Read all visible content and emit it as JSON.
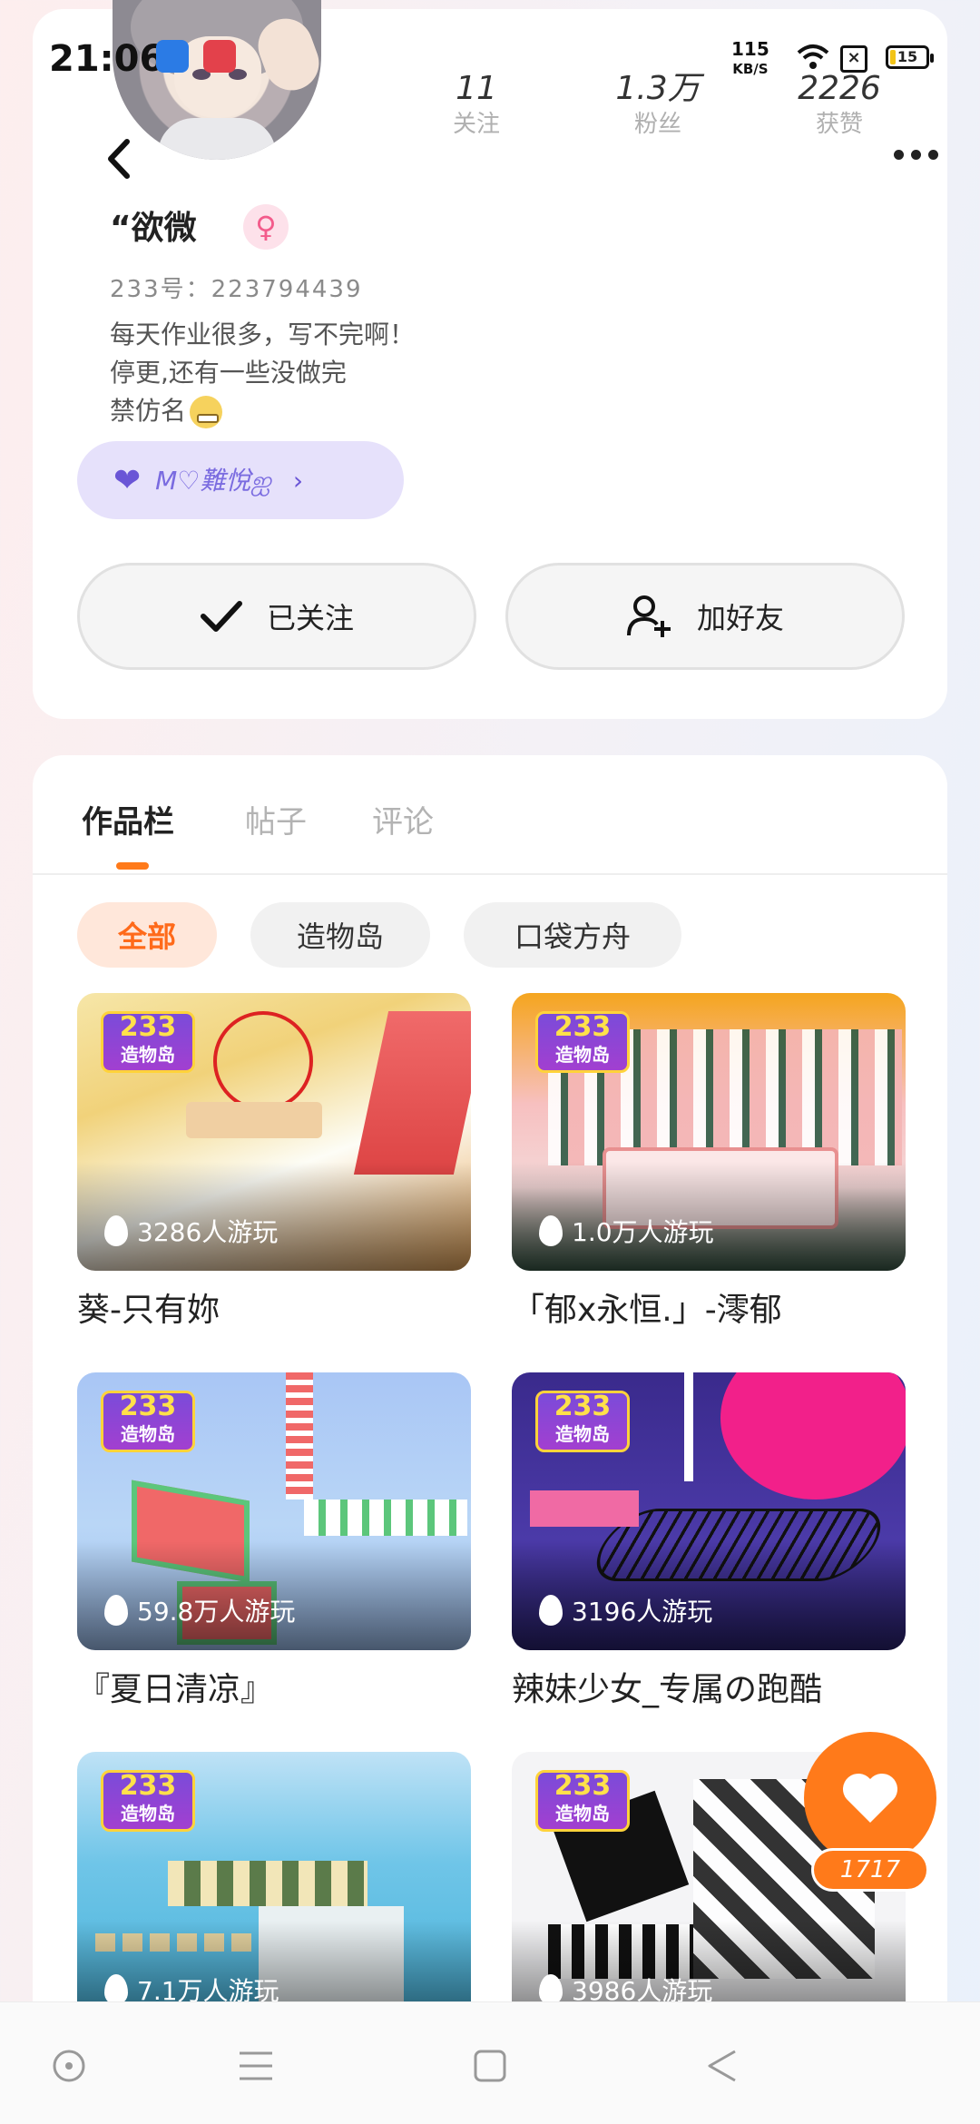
{
  "status_bar": {
    "time": "21:06",
    "net_speed_value": "115",
    "net_speed_unit": "KB/S",
    "battery": "15"
  },
  "profile": {
    "stats": [
      {
        "value": "11",
        "label": "关注"
      },
      {
        "value": "1.3万",
        "label": "粉丝"
      },
      {
        "value": "2226",
        "label": "获赞"
      }
    ],
    "nickname": "“欲微",
    "gender_symbol": "♀",
    "user_id": "233号：223794439",
    "bio_lines": [
      "每天作业很多，写不完啊！",
      "停更,还有一些没做完",
      "禁仿名"
    ],
    "badge_text": "M♡難悅ஐ",
    "follow_button": "已关注",
    "add_friend_button": "加好友"
  },
  "tabs": [
    "作品栏",
    "帖子",
    "评论"
  ],
  "filters": [
    "全部",
    "造物岛",
    "口袋方舟"
  ],
  "games": [
    {
      "title": "葵-只有妳",
      "plays": "3286人游玩",
      "logo_top": "233",
      "logo_bottom": "造物岛"
    },
    {
      "title": "「郁x永恒.」-澪郁",
      "plays": "1.0万人游玩",
      "logo_top": "233",
      "logo_bottom": "造物岛"
    },
    {
      "title": "『夏日清凉』",
      "plays": "59.8万人游玩",
      "logo_top": "233",
      "logo_bottom": "造物岛"
    },
    {
      "title": "辣妹少女_专属の跑酷",
      "plays": "3196人游玩",
      "logo_top": "233",
      "logo_bottom": "造物岛"
    },
    {
      "title": "",
      "plays": "7.1万人游玩",
      "logo_top": "233",
      "logo_bottom": "造物岛"
    },
    {
      "title": "",
      "plays": "3986人游玩",
      "logo_top": "233",
      "logo_bottom": "造物岛"
    }
  ],
  "fab": {
    "icon": "heart-icon",
    "count": "1717"
  },
  "colors": {
    "accent": "#ff7a1a",
    "badge_bg": "#e6e1fb",
    "female": "#f35b8b"
  }
}
